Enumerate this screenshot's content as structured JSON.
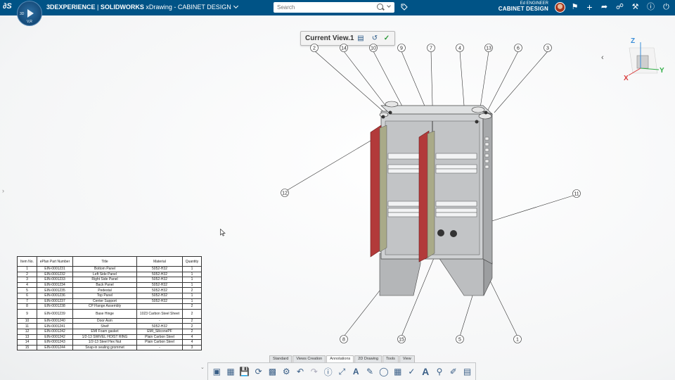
{
  "app": {
    "brand_prefix": "3DEXPERIENCE",
    "brand_separator": " | ",
    "brand_product": "SOLIDWORKS",
    "brand_rest": " xDrawing - CABINET DESIGN",
    "compass_labels": [
      "3D",
      "V,R"
    ]
  },
  "search": {
    "placeholder": "Search"
  },
  "user": {
    "role": "Ed ENGINEER",
    "context": "CABINET DESIGN"
  },
  "toolbar_icons": [
    "avatar",
    "share-icon",
    "add-icon",
    "share-arrow-icon",
    "network-icon",
    "tools-icon",
    "help-icon",
    "power-icon"
  ],
  "view": {
    "title": "Current View.1"
  },
  "balloons": [
    {
      "id": "b2",
      "label": "2"
    },
    {
      "id": "b14",
      "label": "14"
    },
    {
      "id": "b10",
      "label": "10"
    },
    {
      "id": "b9",
      "label": "9"
    },
    {
      "id": "b7",
      "label": "7"
    },
    {
      "id": "b4",
      "label": "4"
    },
    {
      "id": "b13",
      "label": "13"
    },
    {
      "id": "b6",
      "label": "6"
    },
    {
      "id": "b3",
      "label": "3"
    },
    {
      "id": "b12",
      "label": "12"
    },
    {
      "id": "b11",
      "label": "11"
    },
    {
      "id": "b8",
      "label": "8"
    },
    {
      "id": "b15",
      "label": "15"
    },
    {
      "id": "b5",
      "label": "5"
    },
    {
      "id": "b1",
      "label": "1"
    }
  ],
  "triad": {
    "z": "Z",
    "x": "X",
    "y": "Y"
  },
  "bom": {
    "headers": [
      "Item No.",
      "ePlan Part Number",
      "Title",
      "Material",
      "Quantity"
    ],
    "rows": [
      [
        "1",
        "EIN-0001231",
        "Bottom Panel",
        "5052-H32",
        "1"
      ],
      [
        "2",
        "EIN-0001232",
        "Left Side Panel",
        "5052-H32",
        "1"
      ],
      [
        "3",
        "EIN-0001233",
        "Right Side Panel",
        "5052-H32",
        "1"
      ],
      [
        "4",
        "EIN-0001234",
        "Back Panel",
        "5052-H32",
        "1"
      ],
      [
        "5",
        "EIN-0001235",
        "Pedestal",
        "5052-H32",
        "2"
      ],
      [
        "6",
        "EIN-0001236",
        "Top Panel",
        "5052-H32",
        "1"
      ],
      [
        "7",
        "EIN-0001237",
        "Center Support",
        "5052-H32",
        "1"
      ],
      [
        "8",
        "EIN-0001238",
        "CP Flange Assembly",
        "",
        "2"
      ],
      [
        "9",
        "EIN-0001239",
        "Base Hinge",
        "1023 Carbon Steel Sheet",
        "2"
      ],
      [
        "10",
        "EIN-0001240",
        "Door Asm",
        "-",
        "2"
      ],
      [
        "11",
        "EIN-0001241",
        "Shelf",
        "5052-H32",
        "2"
      ],
      [
        "12",
        "EIN-0001242",
        "EMI Foam gasket",
        "EMI_SiliconePF",
        "2"
      ],
      [
        "13",
        "EIN-0001242",
        "1/2-13 SWIVEL HOIST RING",
        "Plain Carbon Steel",
        "4"
      ],
      [
        "14",
        "EIN-0001243",
        "1/2-13 Steel Hex Nut",
        "Plain Carbon Steel",
        "4"
      ],
      [
        "15",
        "EIN-0001244",
        "Snap-in sealing grommet",
        "-",
        "3"
      ]
    ]
  },
  "tabs": [
    "Standard",
    "Views Creation",
    "Annotations",
    "2D Drawing",
    "Tools",
    "View"
  ],
  "active_tab": "Annotations",
  "bottom_tools": [
    "view-3d-icon",
    "section-icon",
    "save-icon",
    "update-icon",
    "drawing-icon",
    "settings-icon",
    "undo-icon",
    "redo-icon",
    "help-icon",
    "dimension-icon",
    "text-icon",
    "note-icon",
    "balloon-icon",
    "table-icon",
    "check-icon",
    "font-icon",
    "datum-icon",
    "weld-icon",
    "bom-icon"
  ]
}
